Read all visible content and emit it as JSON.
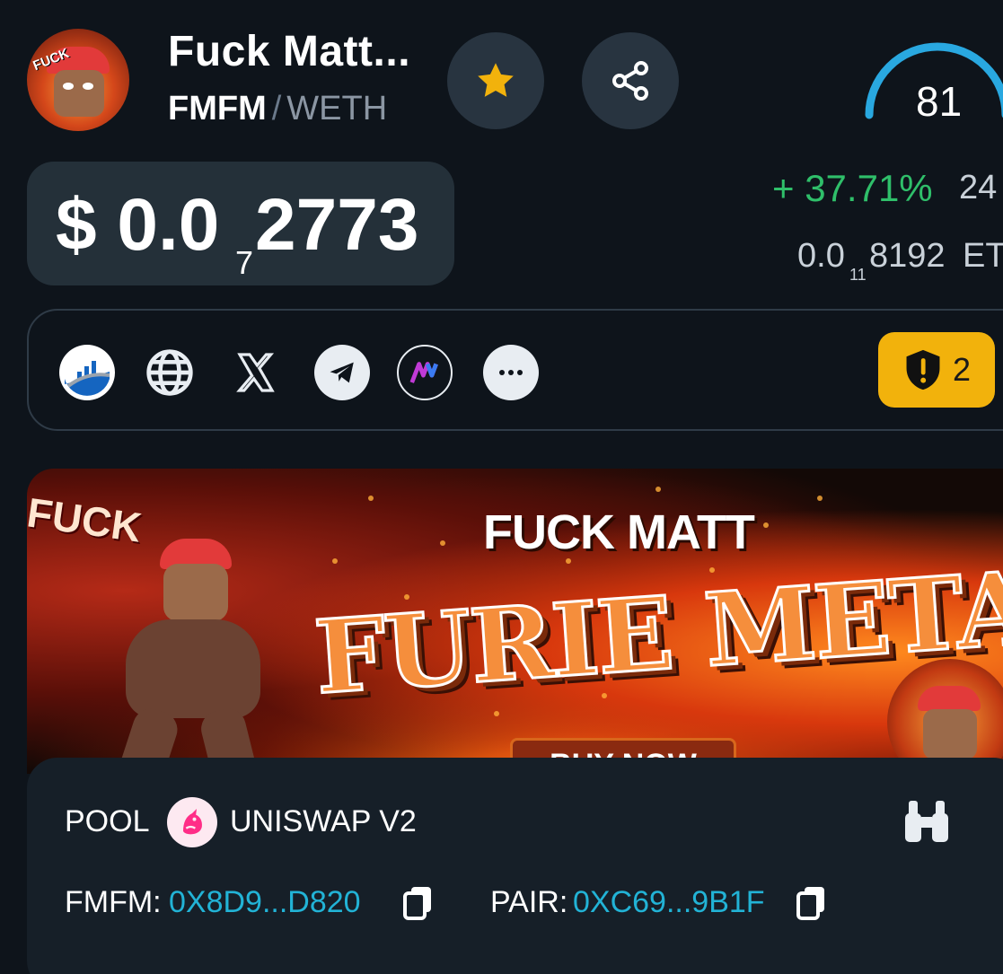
{
  "header": {
    "token_name": "Fuck Matt...",
    "base_symbol": "FMFM",
    "separator": "/",
    "quote_symbol": "WETH",
    "avatar_text": "FUCK",
    "score": "81",
    "score_level": 0.81
  },
  "price": {
    "usd_prefix": "$ 0.0",
    "usd_zero_count": "7",
    "usd_digits": "2773",
    "change": "+ 37.71%",
    "change_period": "24",
    "native_prefix": "0.0",
    "native_zero_count": "11",
    "native_digits": "8192",
    "native_unit": "ETH"
  },
  "links": {
    "items": [
      "chart-icon",
      "globe-icon",
      "x-icon",
      "telegram-icon",
      "app-icon",
      "more-icon"
    ],
    "audit_count": "2"
  },
  "banner": {
    "headline": "FUCK MATT",
    "logo_text": "FURIE META",
    "cta": "BUY NOW",
    "side_word": "FUCK"
  },
  "pool": {
    "label": "POOL",
    "dex_name": "UNISWAP V2",
    "token_label": "FMFM:",
    "token_address": "0X8D9...D820",
    "pair_label": "PAIR:",
    "pair_address": "0XC69...9B1F"
  },
  "colors": {
    "background": "#0e141b",
    "positive": "#2fbf6a",
    "link": "#22b3d6",
    "audit": "#f2b20c",
    "gauge": "#29a8e0"
  }
}
